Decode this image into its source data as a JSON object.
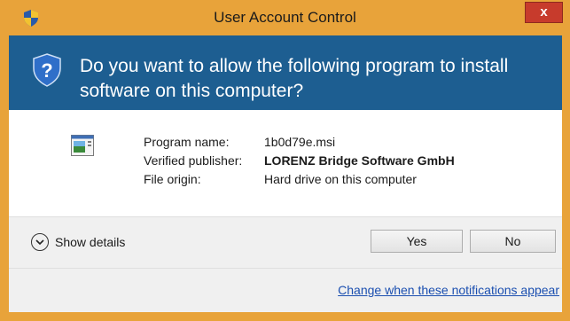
{
  "window": {
    "title": "User Account Control",
    "close_label": "x",
    "frame_color": "#e8a33a"
  },
  "header": {
    "question": "Do you want to allow the following program to install software on this computer?",
    "background_color": "#1d5e91",
    "icon": "uac-shield-question-icon"
  },
  "details": {
    "program_icon": "msi-package-icon",
    "rows": [
      {
        "key": "Program name:",
        "value": "1b0d79e.msi",
        "bold": false
      },
      {
        "key": "Verified publisher:",
        "value": "LORENZ Bridge Software GmbH",
        "bold": true
      },
      {
        "key": "File origin:",
        "value": "Hard drive on this computer",
        "bold": false
      }
    ]
  },
  "footer": {
    "show_details_label": "Show details",
    "yes_label": "Yes",
    "no_label": "No",
    "notifications_link": "Change when these notifications appear"
  }
}
